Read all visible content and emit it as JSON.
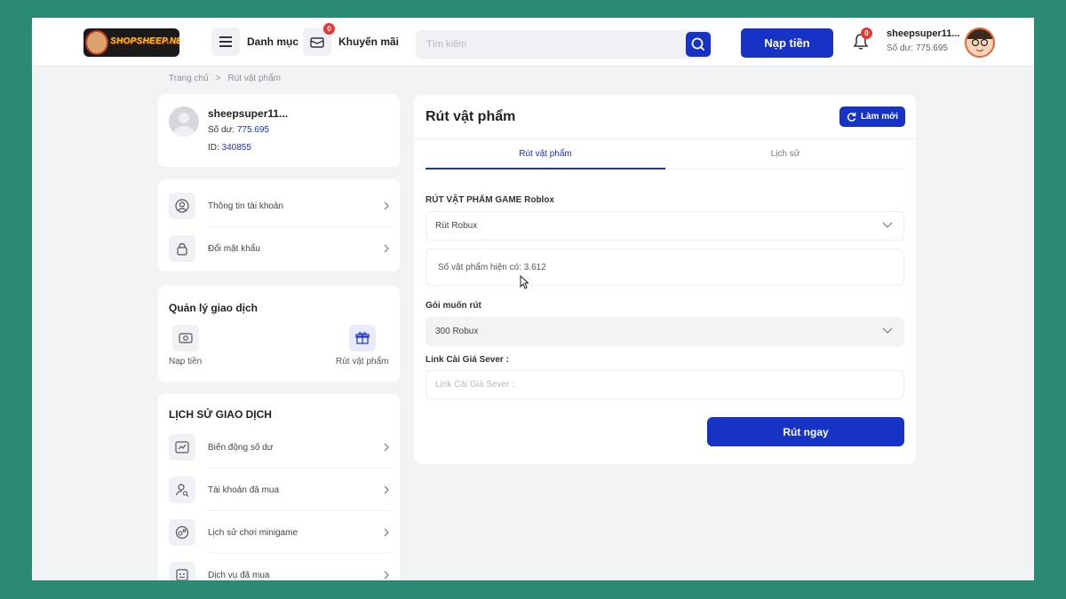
{
  "header": {
    "logo_text": "SHOPSHEEP.NET",
    "menu_label": "Danh mục",
    "promo_label": "Khuyến mãi",
    "promo_badge": "0",
    "search_placeholder": "Tìm kiếm",
    "topup_label": "Nạp tiền",
    "notif_badge": "0",
    "user_name": "sheepsuper11...",
    "user_balance": "Số dư: 775.695"
  },
  "breadcrumb": {
    "home": "Trang chủ",
    "separator": ">",
    "current": "Rút vật phẩm"
  },
  "profile": {
    "name": "sheepsuper11...",
    "balance_label": "Số dư:",
    "balance_value": "775.695",
    "id_label": "ID:",
    "id_value": "340855"
  },
  "account_menu": [
    {
      "label": "Thông tin tài khoản",
      "icon": "user-circle-icon"
    },
    {
      "label": "Đổi mật khẩu",
      "icon": "lock-icon"
    }
  ],
  "transactions": {
    "title": "Quản lý giao dịch",
    "items": [
      {
        "label": "Nạp tiền",
        "icon": "wallet-icon"
      },
      {
        "label": "Rút vật phẩm",
        "icon": "gift-icon"
      }
    ]
  },
  "history": {
    "title": "LỊCH SỬ GIAO DỊCH",
    "items": [
      {
        "label": "Biến động số dư",
        "icon": "balance-icon"
      },
      {
        "label": "Tài khoản đã mua",
        "icon": "user-search-icon"
      },
      {
        "label": "Lịch sử chơi minigame",
        "icon": "gamepad-icon"
      },
      {
        "label": "Dịch vụ đã mua",
        "icon": "service-icon"
      }
    ]
  },
  "main": {
    "title": "Rút vật phẩm",
    "refresh_label": "Làm mới",
    "tabs": [
      "Rút vật phẩm",
      "Lịch sử"
    ],
    "game_label": "RÚT VẬT PHẨM GAME Roblox",
    "item_select": "Rút Robux",
    "available_text": "Số vật phẩm hiện có: 3.612",
    "package_label": "Gói muốn rút",
    "package_select": "300 Robux",
    "link_label": "Link Cài Giá Sever :",
    "link_placeholder": "Link Cài Giá Sever :",
    "submit_label": "Rút ngay"
  },
  "colors": {
    "accent": "#1633c6",
    "background": "#f2f3f5",
    "outer_border": "#2a8a74",
    "badge": "#e53935"
  }
}
